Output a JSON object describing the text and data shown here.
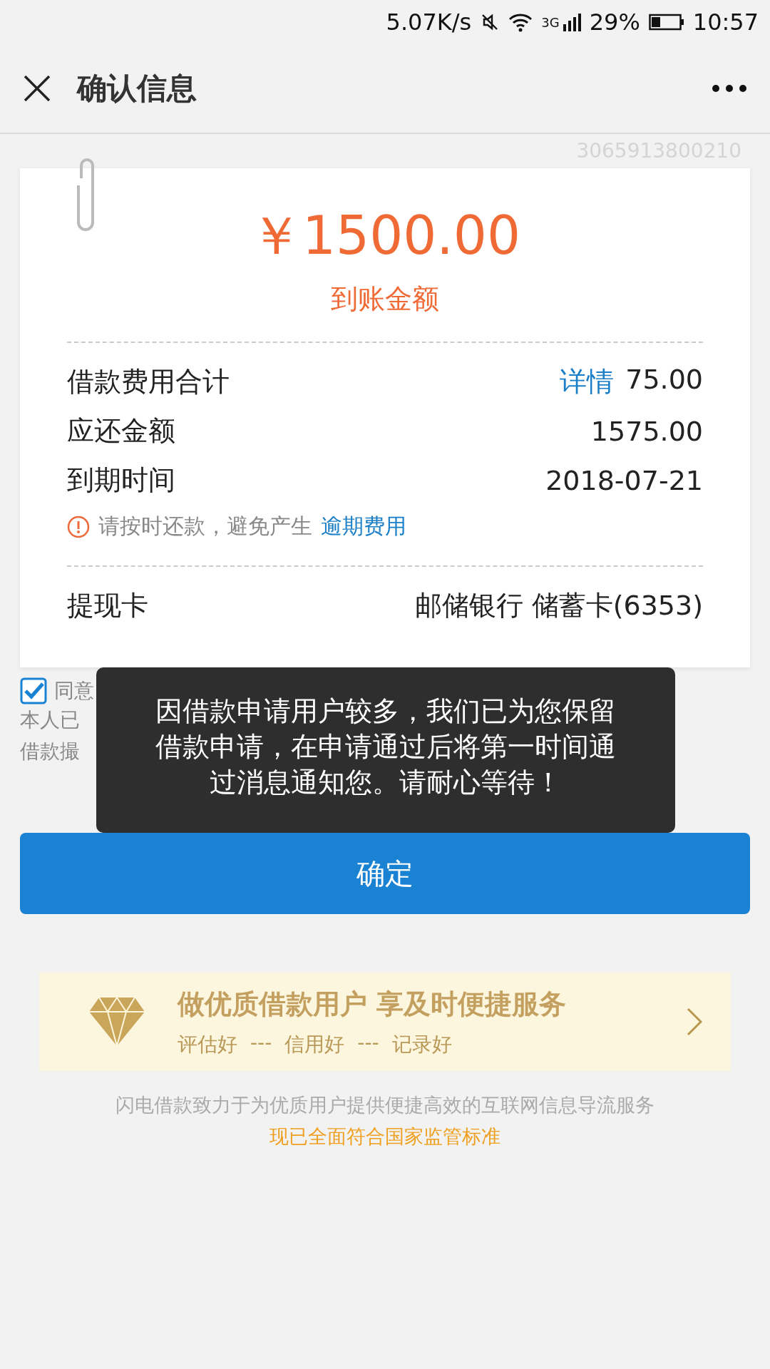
{
  "status_bar": {
    "speed": "5.07K/s",
    "network": "3G",
    "battery": "29%",
    "time": "10:57"
  },
  "header": {
    "title": "确认信息"
  },
  "order_number": "3065913800210",
  "amount": {
    "value": "￥1500.00",
    "label": "到账金额"
  },
  "fees": [
    {
      "label": "借款费用合计",
      "link": "详情",
      "value": "75.00"
    },
    {
      "label": "应还金额",
      "value": "1575.00"
    },
    {
      "label": "到期时间",
      "value": "2018-07-21"
    }
  ],
  "notice": {
    "text": "请按时还款，避免产生",
    "link": "逾期费用"
  },
  "card": {
    "label": "提现卡",
    "value": "邮储银行 储蓄卡(6353)"
  },
  "agreement": {
    "checked": true,
    "prefix": "同意",
    "lines": [
      "本人已",
      "借款撮"
    ]
  },
  "confirm_button": "确定",
  "toast": "因借款申请用户较多，我们已为您保留借款申请，在申请通过后将第一时间通过消息通知您。请耐心等待！",
  "promo": {
    "title": "做优质借款用户 享及时便捷服务",
    "tags": [
      "评估好",
      "---",
      "信用好",
      "---",
      "记录好"
    ]
  },
  "footer": {
    "text": "闪电借款致力于为优质用户提供便捷高效的互联网信息导流服务",
    "highlight": "现已全面符合国家监管标准"
  }
}
